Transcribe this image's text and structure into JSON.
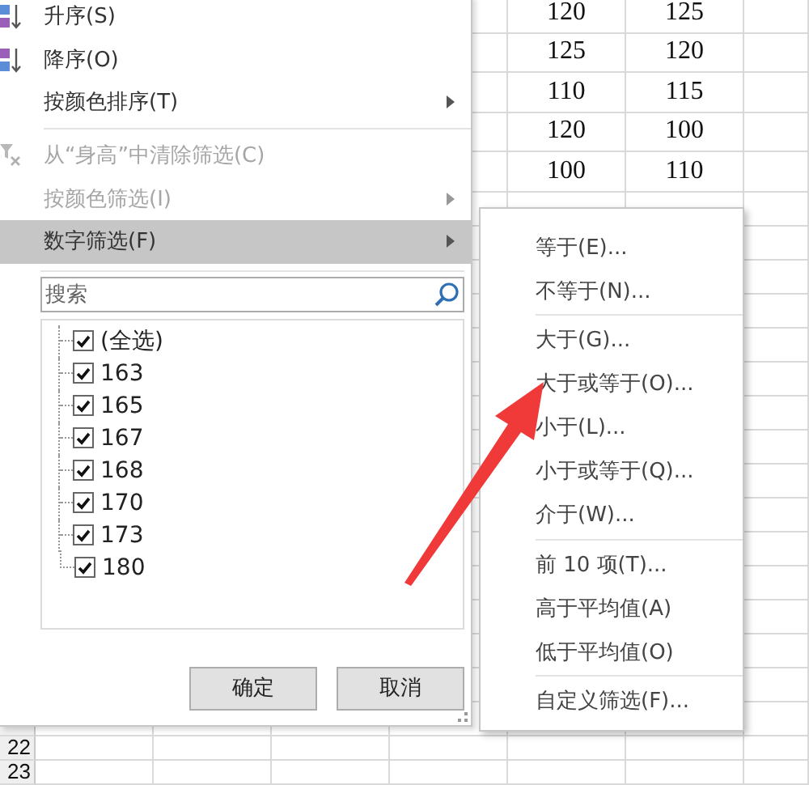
{
  "sheet": {
    "data_rows": [
      {
        "cells": [
          "120",
          "125"
        ]
      },
      {
        "cells": [
          "125",
          "120"
        ]
      },
      {
        "cells": [
          "110",
          "115"
        ]
      },
      {
        "cells": [
          "120",
          "100"
        ]
      },
      {
        "cells": [
          "100",
          "110"
        ]
      }
    ],
    "footer_rows": [
      {
        "header": "22"
      },
      {
        "header": "23"
      }
    ]
  },
  "filter_menu": {
    "items": [
      {
        "kind": "sort_ascending",
        "label": "升序(S)",
        "disabled": false,
        "submenu": false,
        "highlighted": false
      },
      {
        "kind": "sort_descending",
        "label": "降序(O)",
        "disabled": false,
        "submenu": false,
        "highlighted": false
      },
      {
        "kind": "item",
        "label": "按颜色排序(T)",
        "disabled": false,
        "submenu": true,
        "highlighted": false
      },
      {
        "kind": "separator"
      },
      {
        "kind": "clear_filter",
        "label": "从“身高”中清除筛选(C)",
        "disabled": true,
        "submenu": false,
        "highlighted": false
      },
      {
        "kind": "item",
        "label": "按颜色筛选(I)",
        "disabled": true,
        "submenu": true,
        "highlighted": false
      },
      {
        "kind": "item",
        "label": "数字筛选(F)",
        "disabled": false,
        "submenu": true,
        "highlighted": true
      }
    ],
    "search": {
      "placeholder": "搜索"
    },
    "values": [
      {
        "label": "(全选)",
        "checked": true
      },
      {
        "label": "163",
        "checked": true
      },
      {
        "label": "165",
        "checked": true
      },
      {
        "label": "167",
        "checked": true
      },
      {
        "label": "168",
        "checked": true
      },
      {
        "label": "170",
        "checked": true
      },
      {
        "label": "173",
        "checked": true
      },
      {
        "label": "180",
        "checked": true
      }
    ],
    "buttons": [
      "确定",
      "取消"
    ]
  },
  "number_filter_submenu": {
    "items": [
      {
        "kind": "item",
        "label": "等于(E)..."
      },
      {
        "kind": "item",
        "label": "不等于(N)..."
      },
      {
        "kind": "separator"
      },
      {
        "kind": "item",
        "label": "大于(G)..."
      },
      {
        "kind": "item",
        "label": "大于或等于(O)..."
      },
      {
        "kind": "item",
        "label": "小于(L)..."
      },
      {
        "kind": "item",
        "label": "小于或等于(Q)..."
      },
      {
        "kind": "item",
        "label": "介于(W)..."
      },
      {
        "kind": "separator"
      },
      {
        "kind": "item",
        "label": "前 10 项(T)..."
      },
      {
        "kind": "item",
        "label": "高于平均值(A)"
      },
      {
        "kind": "item",
        "label": "低于平均值(O)"
      },
      {
        "kind": "separator"
      },
      {
        "kind": "item",
        "label": "自定义筛选(F)..."
      }
    ]
  }
}
